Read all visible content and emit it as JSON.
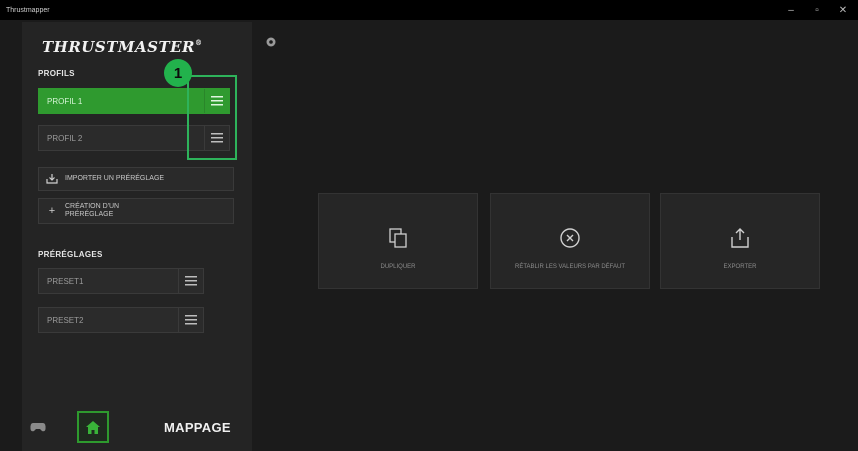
{
  "window": {
    "title": "Thrustmapper"
  },
  "brand": {
    "name": "THRUSTMASTER",
    "registered": "®"
  },
  "profiles": {
    "label": "PROFILS",
    "items": [
      {
        "name": "PROFIL 1",
        "active": true
      },
      {
        "name": "PROFIL 2",
        "active": false
      }
    ],
    "import_label": "IMPORTER UN PRÉRÉGLAGE",
    "create_label_line1": "CRÉATION D'UN",
    "create_label_line2": "PRÉRÉGLAGE"
  },
  "presets": {
    "label": "PRÉRÉGLAGES",
    "items": [
      {
        "name": "PRESET1"
      },
      {
        "name": "PRESET2"
      }
    ]
  },
  "annotation": {
    "number": "1",
    "color": "#2eb35b"
  },
  "bottom": {
    "mappage_label": "MAPPAGE"
  },
  "actions": {
    "duplicate": "DUPLIQUER",
    "reset": "RÉTABLIR LES VALEURS PAR DÉFAUT",
    "export": "EXPORTER"
  },
  "colors": {
    "accent": "#2f9a2f",
    "background": "#1b1b1b",
    "sidebar": "#242424"
  }
}
